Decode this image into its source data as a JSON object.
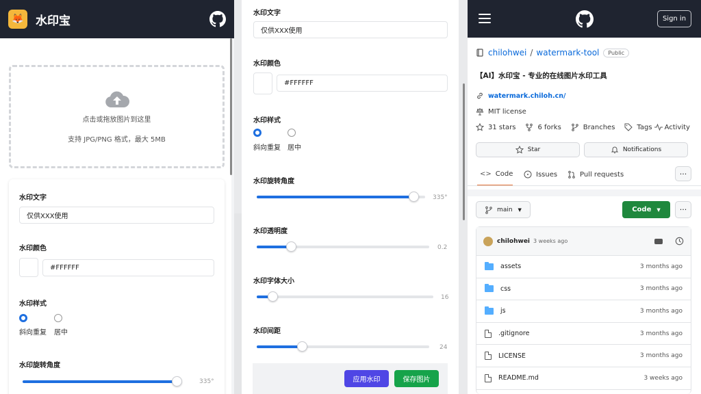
{
  "left": {
    "app_title": "水印宝",
    "logo_icon": "app-logo",
    "upload": {
      "hint": "点击或拖放图片到这里",
      "formats": "支持 JPG/PNG 格式，最大 5MB"
    },
    "form": {
      "text_label": "水印文字",
      "text_value": "仅供XXX使用",
      "color_label": "水印颜色",
      "color_value": "#FFFFFF",
      "style_label": "水印样式",
      "style_options": [
        "斜向重复",
        "居中"
      ],
      "style_selected": "斜向重复",
      "rotation_label": "水印旋转角度",
      "rotation_value": "335°"
    }
  },
  "middle": {
    "text_label": "水印文字",
    "text_value": "仅供XXX使用",
    "color_label": "水印颜色",
    "color_value": "#FFFFFF",
    "style_label": "水印样式",
    "style_options": [
      "斜向重复",
      "居中"
    ],
    "style_selected": "斜向重复",
    "rotation": {
      "label": "水印旋转角度",
      "value": "335°",
      "level": 0.93
    },
    "opacity": {
      "label": "水印透明度",
      "value": "0.2",
      "level": 0.2
    },
    "font_size": {
      "label": "水印字体大小",
      "value": "16",
      "level": 0.09
    },
    "spacing": {
      "label": "水印间距",
      "value": "24",
      "level": 0.26
    },
    "apply_button": "应用水印",
    "save_button": "保存图片",
    "colors": {
      "apply": "#4f46e5",
      "save": "#16a34a",
      "accent": "#1e6fe0"
    }
  },
  "right": {
    "sign_in": "Sign in",
    "owner": "chilohwei",
    "separator": "/",
    "repo": "watermark-tool",
    "visibility": "Public",
    "description": "【AI】水印宝 - 专业的在线图片水印工具",
    "website": "watermark.chiloh.cn/",
    "license": "MIT license",
    "stars": "31 stars",
    "forks": "6 forks",
    "branches": "Branches",
    "tags": "Tags",
    "activity": "Activity",
    "star_button": "Star",
    "notifications_button": "Notifications",
    "tabs": [
      "Code",
      "Issues",
      "Pull requests"
    ],
    "active_tab": "Code",
    "branch": "main",
    "code_button": "Code",
    "commit_author": "chilohwei",
    "commit_time": "3 weeks ago",
    "files": [
      {
        "name": "assets",
        "type": "folder",
        "date": "3 months ago"
      },
      {
        "name": "css",
        "type": "folder",
        "date": "3 months ago"
      },
      {
        "name": "js",
        "type": "folder",
        "date": "3 months ago"
      },
      {
        "name": ".gitignore",
        "type": "file",
        "date": "3 months ago"
      },
      {
        "name": "LICENSE",
        "type": "file",
        "date": "3 months ago"
      },
      {
        "name": "README.md",
        "type": "file",
        "date": "3 weeks ago"
      }
    ],
    "colors": {
      "link": "#0969da",
      "code_button": "#1f883d",
      "tab_underline": "#e36f33"
    }
  }
}
